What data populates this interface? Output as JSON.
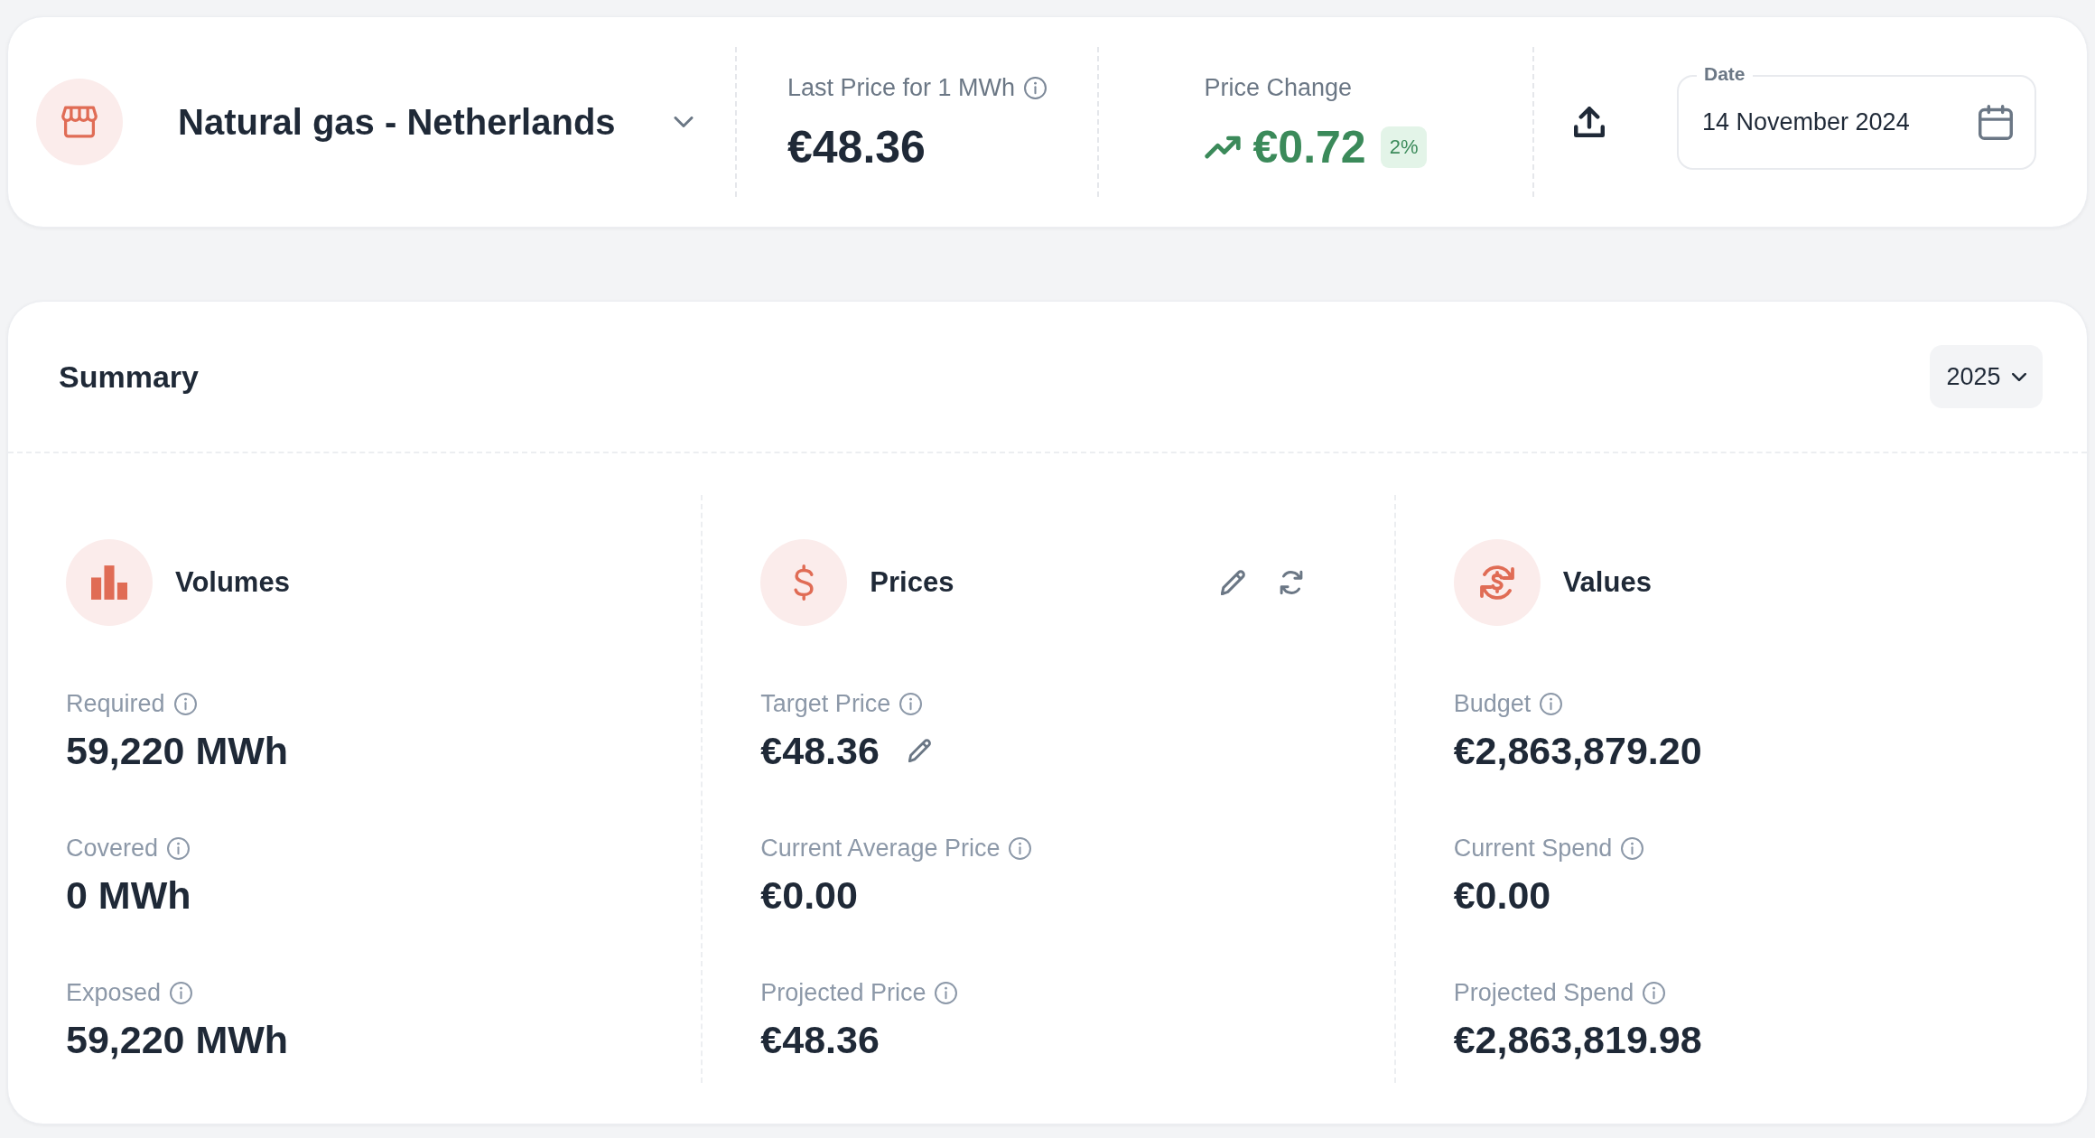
{
  "market_bar": {
    "market": "Natural gas - Netherlands",
    "stats": [
      {
        "label": "Last Price for 1 MWh",
        "info": true,
        "value": "€48.36"
      },
      {
        "label": "Price Change",
        "info": false,
        "value": "€0.72",
        "rising": true,
        "badge": "2%"
      }
    ],
    "date_field": {
      "label": "Date",
      "value": "14 November 2024"
    }
  },
  "summary": {
    "title": "Summary",
    "year": "2025",
    "columns": [
      {
        "kind": "volumes",
        "title": "Volumes",
        "actions": false,
        "metrics": [
          {
            "label": "Required",
            "info": true,
            "value": "59,220 MWh",
            "editable": false
          },
          {
            "label": "Covered",
            "info": true,
            "value": "0 MWh",
            "editable": false
          },
          {
            "label": "Exposed",
            "info": true,
            "value": "59,220 MWh",
            "editable": false
          }
        ]
      },
      {
        "kind": "prices",
        "title": "Prices",
        "actions": true,
        "metrics": [
          {
            "label": "Target Price",
            "info": true,
            "value": "€48.36",
            "editable": true
          },
          {
            "label": "Current Average Price",
            "info": true,
            "value": "€0.00",
            "editable": false
          },
          {
            "label": "Projected Price",
            "info": true,
            "value": "€48.36",
            "editable": false
          }
        ]
      },
      {
        "kind": "values",
        "title": "Values",
        "actions": false,
        "metrics": [
          {
            "label": "Budget",
            "info": true,
            "value": "€2,863,879.20",
            "editable": false
          },
          {
            "label": "Current Spend",
            "info": true,
            "value": "€0.00",
            "editable": false
          },
          {
            "label": "Projected Spend",
            "info": true,
            "value": "€2,863,819.98",
            "editable": false
          }
        ]
      }
    ]
  }
}
